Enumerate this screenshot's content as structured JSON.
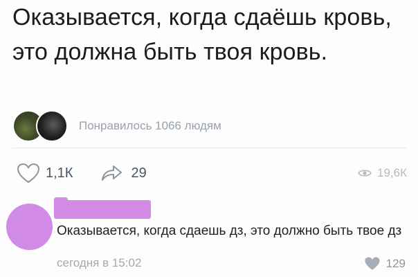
{
  "post": {
    "text": "Оказывается, когда сдаёшь кровь, это должна быть твоя кровь."
  },
  "likes_summary": {
    "text": "Понравилось 1066 людям"
  },
  "actions": {
    "likes_count": "1,1К",
    "shares_count": "29",
    "views_count": "19,6К"
  },
  "comment": {
    "text": "Оказывается, когда сдаешь дз, это должно быть твое дз",
    "time": "сегодня в 15:02",
    "likes_count": "129",
    "avatar_color": "#d18ae6"
  },
  "icons": {
    "like": "heart-outline-icon",
    "share": "share-arrow-icon",
    "views": "eye-icon",
    "comment_like": "heart-filled-icon"
  }
}
